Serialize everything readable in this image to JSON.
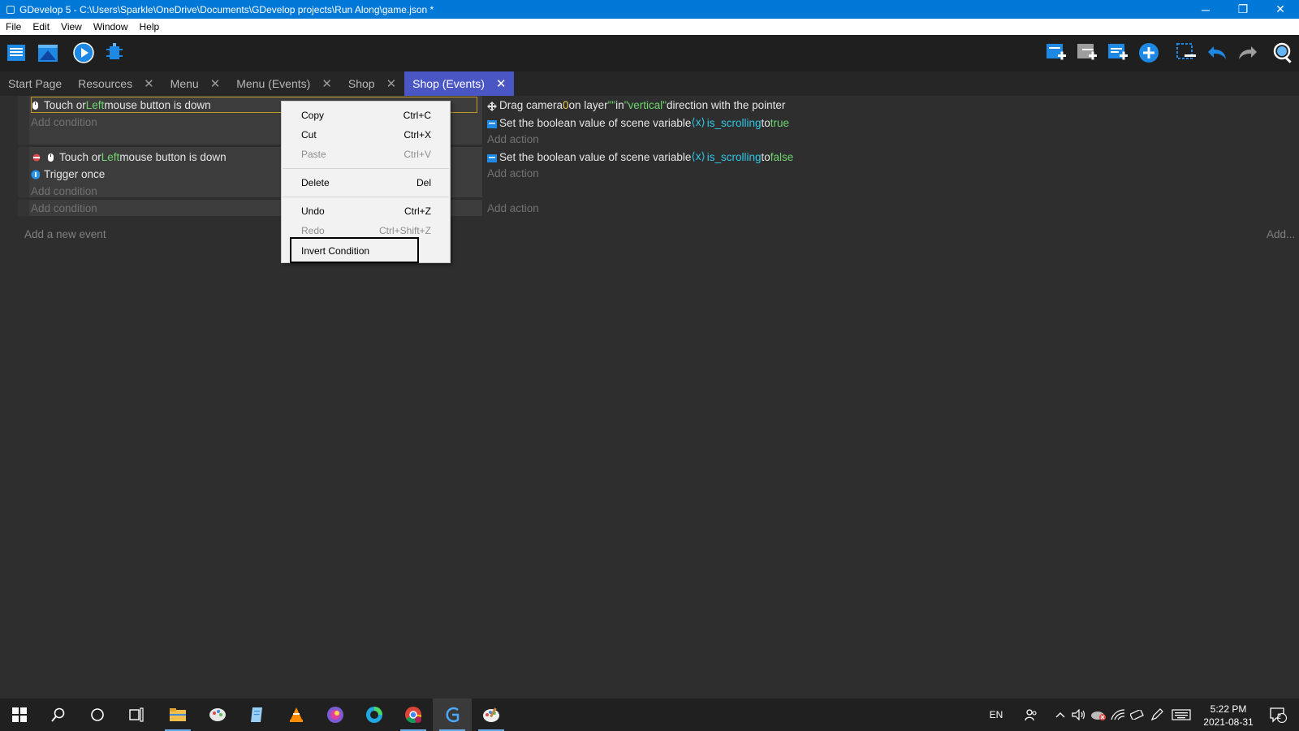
{
  "window": {
    "title": "GDevelop 5 - C:\\Users\\Sparkle\\OneDrive\\Documents\\GDevelop projects\\Run Along\\game.json *",
    "minimize": "─",
    "restore": "❐",
    "close": "✕"
  },
  "menubar": {
    "items": [
      "File",
      "Edit",
      "View",
      "Window",
      "Help"
    ]
  },
  "toolbar": {
    "left_icons": [
      "project-manager-icon",
      "scene-list-icon",
      "preview-play-icon",
      "debugger-icon"
    ],
    "right_icons": [
      "add-event-icon",
      "add-sub-event-icon",
      "add-comment-icon",
      "add-other-icon",
      "delete-event-icon",
      "undo-icon",
      "redo-icon",
      "search-icon"
    ],
    "accent": "#2196f3"
  },
  "tabs": [
    {
      "label": "Start Page",
      "closable": false
    },
    {
      "label": "Resources",
      "closable": true,
      "close": "✕"
    },
    {
      "label": "Menu",
      "closable": true,
      "close": "✕"
    },
    {
      "label": "Menu (Events)",
      "closable": true,
      "close": "✕"
    },
    {
      "label": "Shop",
      "closable": true,
      "close": "✕"
    },
    {
      "label": "Shop (Events)",
      "closable": true,
      "close": "✕",
      "active": true
    }
  ],
  "events": {
    "event1": {
      "condition": {
        "pre": "Touch or ",
        "highlight": "Left",
        "post": " mouse button is down"
      },
      "add_condition": "Add condition",
      "action1": {
        "pre": "Drag camera ",
        "num": "0",
        "mid1": " on layer ",
        "layer": "\"\"",
        "mid2": " in ",
        "dir": "\"vertical\"",
        "post": " direction with the pointer"
      },
      "action2": {
        "pre": "Set the boolean value of scene variable ",
        "var": "is_scrolling",
        "mid": " to ",
        "val": "true"
      },
      "add_action": "Add action"
    },
    "event2": {
      "condition1": {
        "pre": "Touch or ",
        "highlight": "Left",
        "post": " mouse button is down"
      },
      "condition2": {
        "label": "Trigger once"
      },
      "add_condition": "Add condition",
      "action1": {
        "pre": "Set the boolean value of scene variable ",
        "var": "is_scrolling",
        "mid": " to ",
        "val": "false"
      },
      "add_action": "Add action"
    },
    "event3": {
      "add_condition": "Add condition",
      "add_action": "Add action"
    },
    "add_new_event": "Add a new event",
    "add_more": "Add..."
  },
  "context_menu": {
    "items": [
      {
        "label": "Copy",
        "shortcut": "Ctrl+C",
        "enabled": true
      },
      {
        "label": "Cut",
        "shortcut": "Ctrl+X",
        "enabled": true
      },
      {
        "label": "Paste",
        "shortcut": "Ctrl+V",
        "enabled": false
      },
      {
        "label": "Delete",
        "shortcut": "Del",
        "enabled": true
      },
      {
        "label": "Undo",
        "shortcut": "Ctrl+Z",
        "enabled": true
      },
      {
        "label": "Redo",
        "shortcut": "Ctrl+Shift+Z",
        "enabled": false
      },
      {
        "label": "Invert Condition",
        "shortcut": "",
        "enabled": true
      }
    ]
  },
  "taskbar": {
    "apps": [
      "windows-start-icon",
      "search-icon",
      "cortana-icon",
      "task-view-icon",
      "file-explorer-icon",
      "paint-3d-icon",
      "notepad-icon",
      "vlc-icon",
      "photos-icon",
      "edge-icon",
      "chrome-icon",
      "gdevelop-icon",
      "paint-icon"
    ],
    "language": "EN",
    "time": "5:22 PM",
    "date": "2021-08-31",
    "notifications": "2"
  }
}
